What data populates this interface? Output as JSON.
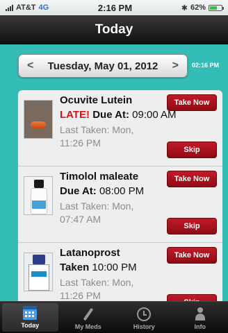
{
  "status_bar": {
    "carrier": "AT&T",
    "network": "4G",
    "time": "2:16 PM",
    "battery": "62%",
    "battery_level": 0.62
  },
  "nav": {
    "title": "Today"
  },
  "date_picker": {
    "prev": "<",
    "date": "Tuesday, May 01, 2012",
    "next": ">",
    "current_time": "02:16 PM"
  },
  "medications": [
    {
      "name": "Ocuvite Lutein",
      "late_label": "LATE!",
      "status_label": "Due At:",
      "status_time": "09:00 AM",
      "last_taken_line1": "Last Taken: Mon,",
      "last_taken_line2": "11:26 PM",
      "take_now": "Take Now",
      "skip": "Skip"
    },
    {
      "name": "Timolol maleate",
      "status_label": "Due At:",
      "status_time": "08:00 PM",
      "last_taken_line1": "Last Taken: Mon,",
      "last_taken_line2": "07:47 AM",
      "take_now": "Take Now",
      "skip": "Skip"
    },
    {
      "name": "Latanoprost",
      "status_label": "Taken",
      "status_time": "10:00 PM",
      "last_taken_line1": "Last Taken: Mon,",
      "last_taken_line2": "11:26 PM",
      "take_now": "Take Now",
      "skip": "Skip"
    }
  ],
  "tab_bar": {
    "tabs": [
      {
        "label": "Today",
        "icon": "calendar-icon"
      },
      {
        "label": "My Meds",
        "icon": "dropper-icon"
      },
      {
        "label": "History",
        "icon": "clock-icon"
      },
      {
        "label": "Info",
        "icon": "person-icon"
      }
    ]
  },
  "colors": {
    "content_bg": "#34bcb6",
    "late": "#d8101a",
    "button_red": "#c21a28"
  }
}
